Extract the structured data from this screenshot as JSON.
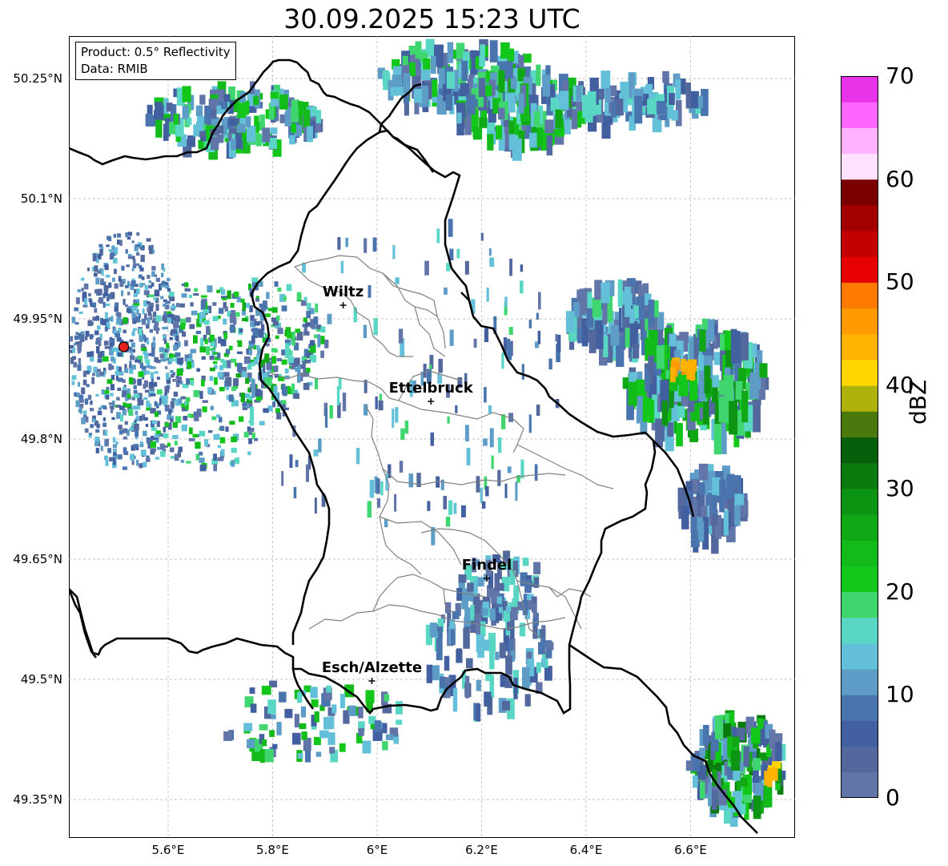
{
  "title": "30.09.2025 15:23 UTC",
  "info_box": {
    "product_line": "Product: 0.5° Reflectivity",
    "data_line": "Data: RMIB"
  },
  "map": {
    "lon_range": [
      5.41,
      6.8
    ],
    "lat_range": [
      49.302,
      50.303
    ],
    "grid": true,
    "lat_ticks": [
      "50.25°N",
      "50.1°N",
      "49.95°N",
      "49.8°N",
      "49.65°N",
      "49.5°N",
      "49.35°N"
    ],
    "lat_tick_values": [
      50.25,
      50.1,
      49.95,
      49.8,
      49.65,
      49.5,
      49.35
    ],
    "lon_ticks": [
      "5.6°E",
      "5.8°E",
      "6°E",
      "6.2°E",
      "6.4°E",
      "6.6°E"
    ],
    "lon_tick_values": [
      5.6,
      5.8,
      6.0,
      6.2,
      6.4,
      6.6
    ],
    "radar_site": {
      "lon": 5.515,
      "lat": 49.915,
      "color": "#e8231f"
    },
    "cities": [
      {
        "name": "Wiltz",
        "lon": 5.935,
        "lat": 49.967
      },
      {
        "name": "Ettelbruck",
        "lon": 6.103,
        "lat": 49.847
      },
      {
        "name": "Findel",
        "lon": 6.21,
        "lat": 49.626
      },
      {
        "name": "Esch/Alzette",
        "lon": 5.99,
        "lat": 49.498
      }
    ],
    "border_color": "#000000",
    "canton_color": "#808080"
  },
  "colorbar": {
    "label": "dBZ",
    "ticks": [
      "0",
      "10",
      "20",
      "30",
      "40",
      "50",
      "60",
      "70"
    ],
    "min": 0,
    "max": 70,
    "colors": [
      "#6275a8",
      "#53699e",
      "#425f9f",
      "#4a74ad",
      "#5c9cc6",
      "#64c0d8",
      "#5ad6c4",
      "#3fd66f",
      "#13c71a",
      "#12ba1a",
      "#10a815",
      "#0e9413",
      "#0b7a0f",
      "#075f0b",
      "#4a7a0e",
      "#aeb20a",
      "#ffd600",
      "#ffb300",
      "#ff9a00",
      "#ff7a00",
      "#e60000",
      "#c50000",
      "#a30000",
      "#7a0000",
      "#ffe0ff",
      "#ffb3ff",
      "#ff66ff",
      "#e833e8"
    ]
  }
}
